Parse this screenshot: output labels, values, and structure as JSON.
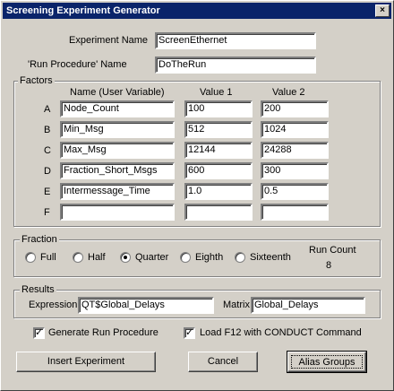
{
  "window": {
    "title": "Screening Experiment Generator",
    "close_glyph": "×"
  },
  "experiment": {
    "name_label": "Experiment Name",
    "name_value": "ScreenEthernet",
    "run_label": "'Run Procedure' Name",
    "run_value": "DoTheRun"
  },
  "factors": {
    "title": "Factors",
    "col_name": "Name (User Variable)",
    "col_v1": "Value 1",
    "col_v2": "Value 2",
    "rows": [
      {
        "letter": "A",
        "name": "Node_Count",
        "v1": "100",
        "v2": "200"
      },
      {
        "letter": "B",
        "name": "Min_Msg",
        "v1": "512",
        "v2": "1024"
      },
      {
        "letter": "C",
        "name": "Max_Msg",
        "v1": "12144",
        "v2": "24288"
      },
      {
        "letter": "D",
        "name": "Fraction_Short_Msgs",
        "v1": "600",
        "v2": "300"
      },
      {
        "letter": "E",
        "name": "Intermessage_Time",
        "v1": "1.0",
        "v2": "0.5"
      },
      {
        "letter": "F",
        "name": "",
        "v1": "",
        "v2": ""
      }
    ]
  },
  "fraction": {
    "title": "Fraction",
    "options": [
      "Full",
      "Half",
      "Quarter",
      "Eighth",
      "Sixteenth"
    ],
    "selected": "Quarter",
    "run_count_label": "Run Count",
    "run_count": "8"
  },
  "results": {
    "title": "Results",
    "expression_label": "Expression",
    "expression_value": "QT$Global_Delays",
    "matrix_label": "Matrix",
    "matrix_value": "Global_Delays"
  },
  "options": {
    "generate_label": "Generate Run Procedure",
    "generate_checked": true,
    "load_label": "Load F12 with CONDUCT Command",
    "load_checked": true
  },
  "buttons": {
    "insert": "Insert Experiment",
    "cancel": "Cancel",
    "alias": "Alias Groups"
  }
}
